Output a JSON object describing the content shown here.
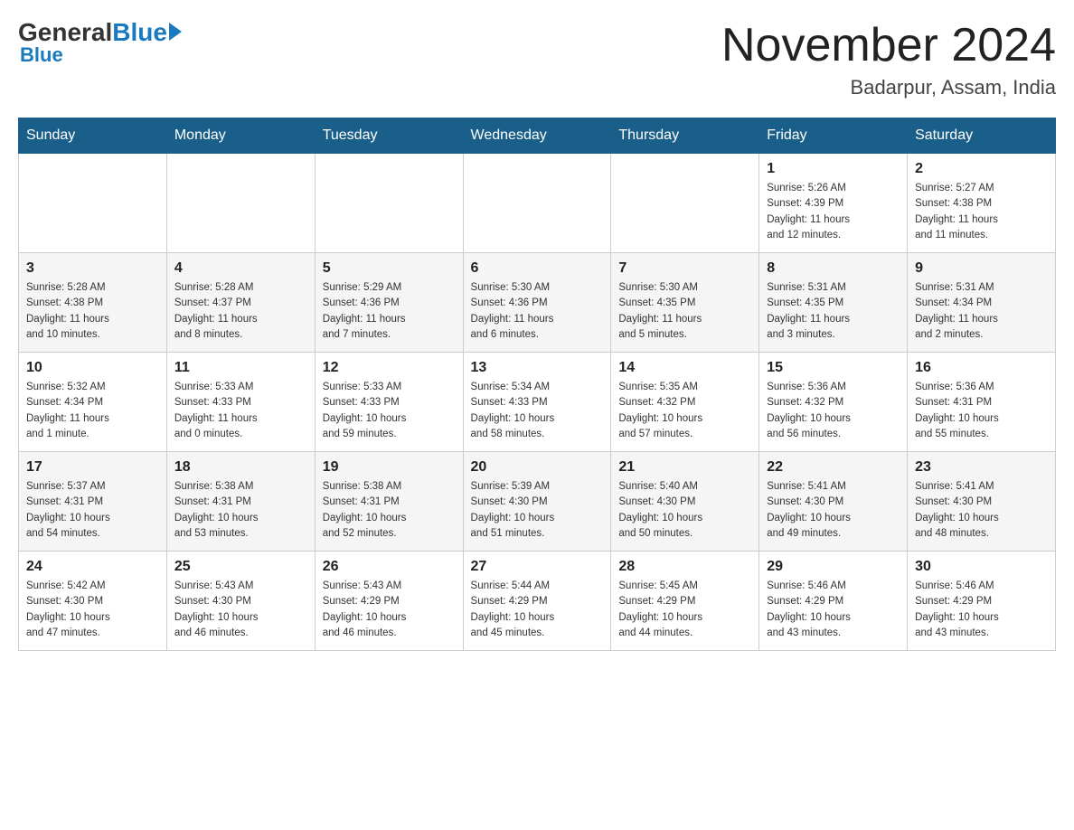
{
  "header": {
    "logo_general": "General",
    "logo_blue": "Blue",
    "month_title": "November 2024",
    "location": "Badarpur, Assam, India"
  },
  "weekdays": [
    "Sunday",
    "Monday",
    "Tuesday",
    "Wednesday",
    "Thursday",
    "Friday",
    "Saturday"
  ],
  "weeks": [
    [
      {
        "day": "",
        "info": ""
      },
      {
        "day": "",
        "info": ""
      },
      {
        "day": "",
        "info": ""
      },
      {
        "day": "",
        "info": ""
      },
      {
        "day": "",
        "info": ""
      },
      {
        "day": "1",
        "info": "Sunrise: 5:26 AM\nSunset: 4:39 PM\nDaylight: 11 hours\nand 12 minutes."
      },
      {
        "day": "2",
        "info": "Sunrise: 5:27 AM\nSunset: 4:38 PM\nDaylight: 11 hours\nand 11 minutes."
      }
    ],
    [
      {
        "day": "3",
        "info": "Sunrise: 5:28 AM\nSunset: 4:38 PM\nDaylight: 11 hours\nand 10 minutes."
      },
      {
        "day": "4",
        "info": "Sunrise: 5:28 AM\nSunset: 4:37 PM\nDaylight: 11 hours\nand 8 minutes."
      },
      {
        "day": "5",
        "info": "Sunrise: 5:29 AM\nSunset: 4:36 PM\nDaylight: 11 hours\nand 7 minutes."
      },
      {
        "day": "6",
        "info": "Sunrise: 5:30 AM\nSunset: 4:36 PM\nDaylight: 11 hours\nand 6 minutes."
      },
      {
        "day": "7",
        "info": "Sunrise: 5:30 AM\nSunset: 4:35 PM\nDaylight: 11 hours\nand 5 minutes."
      },
      {
        "day": "8",
        "info": "Sunrise: 5:31 AM\nSunset: 4:35 PM\nDaylight: 11 hours\nand 3 minutes."
      },
      {
        "day": "9",
        "info": "Sunrise: 5:31 AM\nSunset: 4:34 PM\nDaylight: 11 hours\nand 2 minutes."
      }
    ],
    [
      {
        "day": "10",
        "info": "Sunrise: 5:32 AM\nSunset: 4:34 PM\nDaylight: 11 hours\nand 1 minute."
      },
      {
        "day": "11",
        "info": "Sunrise: 5:33 AM\nSunset: 4:33 PM\nDaylight: 11 hours\nand 0 minutes."
      },
      {
        "day": "12",
        "info": "Sunrise: 5:33 AM\nSunset: 4:33 PM\nDaylight: 10 hours\nand 59 minutes."
      },
      {
        "day": "13",
        "info": "Sunrise: 5:34 AM\nSunset: 4:33 PM\nDaylight: 10 hours\nand 58 minutes."
      },
      {
        "day": "14",
        "info": "Sunrise: 5:35 AM\nSunset: 4:32 PM\nDaylight: 10 hours\nand 57 minutes."
      },
      {
        "day": "15",
        "info": "Sunrise: 5:36 AM\nSunset: 4:32 PM\nDaylight: 10 hours\nand 56 minutes."
      },
      {
        "day": "16",
        "info": "Sunrise: 5:36 AM\nSunset: 4:31 PM\nDaylight: 10 hours\nand 55 minutes."
      }
    ],
    [
      {
        "day": "17",
        "info": "Sunrise: 5:37 AM\nSunset: 4:31 PM\nDaylight: 10 hours\nand 54 minutes."
      },
      {
        "day": "18",
        "info": "Sunrise: 5:38 AM\nSunset: 4:31 PM\nDaylight: 10 hours\nand 53 minutes."
      },
      {
        "day": "19",
        "info": "Sunrise: 5:38 AM\nSunset: 4:31 PM\nDaylight: 10 hours\nand 52 minutes."
      },
      {
        "day": "20",
        "info": "Sunrise: 5:39 AM\nSunset: 4:30 PM\nDaylight: 10 hours\nand 51 minutes."
      },
      {
        "day": "21",
        "info": "Sunrise: 5:40 AM\nSunset: 4:30 PM\nDaylight: 10 hours\nand 50 minutes."
      },
      {
        "day": "22",
        "info": "Sunrise: 5:41 AM\nSunset: 4:30 PM\nDaylight: 10 hours\nand 49 minutes."
      },
      {
        "day": "23",
        "info": "Sunrise: 5:41 AM\nSunset: 4:30 PM\nDaylight: 10 hours\nand 48 minutes."
      }
    ],
    [
      {
        "day": "24",
        "info": "Sunrise: 5:42 AM\nSunset: 4:30 PM\nDaylight: 10 hours\nand 47 minutes."
      },
      {
        "day": "25",
        "info": "Sunrise: 5:43 AM\nSunset: 4:30 PM\nDaylight: 10 hours\nand 46 minutes."
      },
      {
        "day": "26",
        "info": "Sunrise: 5:43 AM\nSunset: 4:29 PM\nDaylight: 10 hours\nand 46 minutes."
      },
      {
        "day": "27",
        "info": "Sunrise: 5:44 AM\nSunset: 4:29 PM\nDaylight: 10 hours\nand 45 minutes."
      },
      {
        "day": "28",
        "info": "Sunrise: 5:45 AM\nSunset: 4:29 PM\nDaylight: 10 hours\nand 44 minutes."
      },
      {
        "day": "29",
        "info": "Sunrise: 5:46 AM\nSunset: 4:29 PM\nDaylight: 10 hours\nand 43 minutes."
      },
      {
        "day": "30",
        "info": "Sunrise: 5:46 AM\nSunset: 4:29 PM\nDaylight: 10 hours\nand 43 minutes."
      }
    ]
  ]
}
